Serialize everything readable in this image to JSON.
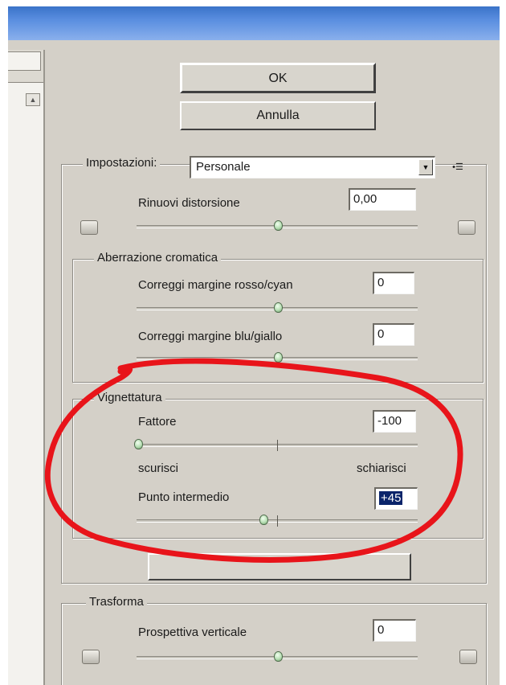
{
  "buttons": {
    "ok": "OK",
    "cancel": "Annulla"
  },
  "settings": {
    "label": "Impostazioni:",
    "value": "Personale"
  },
  "distortion": {
    "label": "Rinuovi distorsione",
    "value": "0,00",
    "slider": 0
  },
  "chromatic": {
    "title": "Aberrazione cromatica",
    "red_cyan": {
      "label": "Correggi margine rosso/cyan",
      "value": "0",
      "slider": 0
    },
    "blue_yellow": {
      "label": "Correggi margine blu/giallo",
      "value": "0",
      "slider": 0
    }
  },
  "vignette": {
    "title": "Vignettatura",
    "amount": {
      "label": "Fattore",
      "value": "-100",
      "slider": -100
    },
    "darken_label": "scurisci",
    "lighten_label": "schiarisci",
    "midpoint": {
      "label": "Punto intermedio",
      "value": "+45",
      "slider": 45
    }
  },
  "transform": {
    "title": "Trasforma",
    "vertical_perspective": {
      "label": "Prospettiva verticale",
      "value": "0",
      "slider": 0
    }
  },
  "annotation_color": "#e8141a",
  "icons": {
    "menu": "flyout-menu-icon",
    "preset_dropdown": "dropdown-arrow-icon"
  }
}
